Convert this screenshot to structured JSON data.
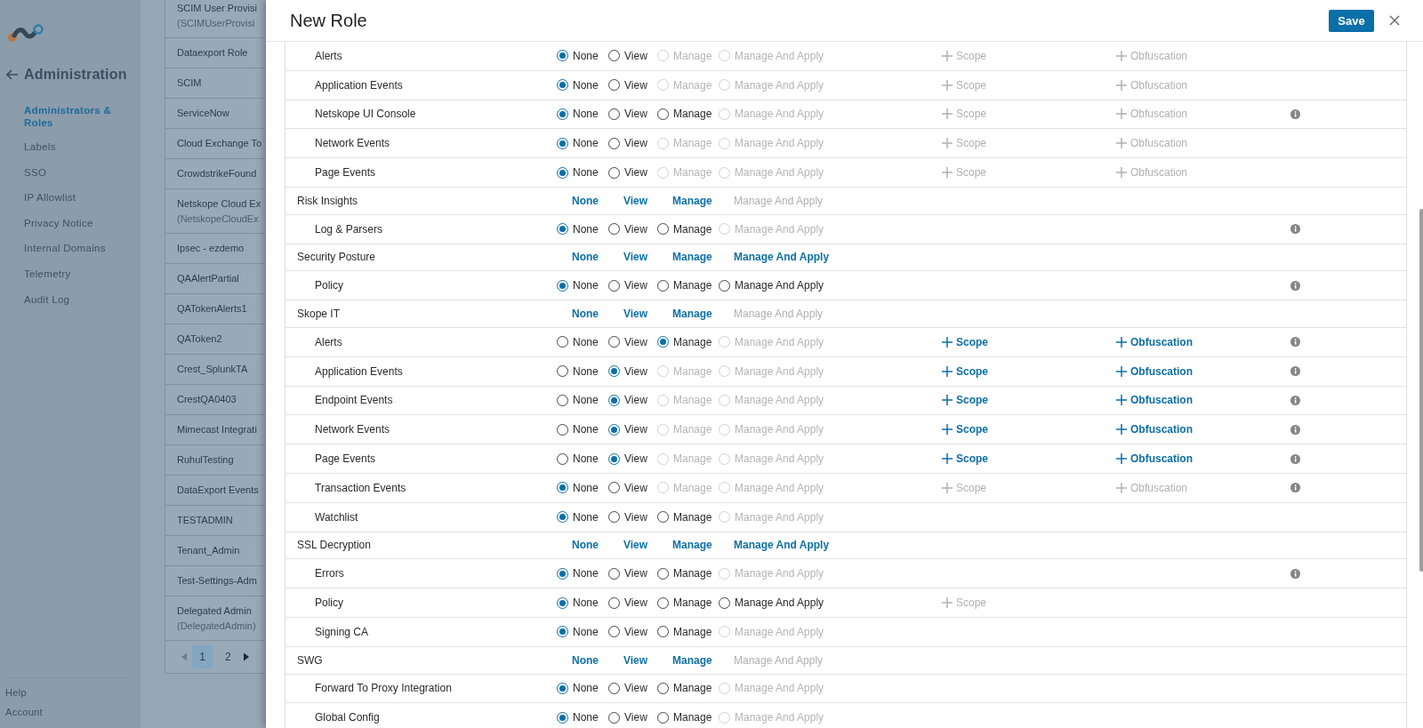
{
  "background": {
    "sidebar": {
      "title": "Administration",
      "items": [
        {
          "label": "Administrators & Roles",
          "selected": true
        },
        {
          "label": "Labels",
          "selected": false
        },
        {
          "label": "SSO",
          "selected": false
        },
        {
          "label": "IP Allowlist",
          "selected": false
        },
        {
          "label": "Privacy Notice",
          "selected": false
        },
        {
          "label": "Internal Domains",
          "selected": false
        },
        {
          "label": "Telemetry",
          "selected": false
        },
        {
          "label": "Audit Log",
          "selected": false
        }
      ],
      "footer_links": [
        "Help",
        "Account"
      ]
    },
    "roles_list": {
      "items": [
        {
          "name": "SCIM User Provisi",
          "subtitle": "(SCIMUserProvisi"
        },
        {
          "name": "Dataexport Role"
        },
        {
          "name": "SCIM"
        },
        {
          "name": "ServiceNow"
        },
        {
          "name": "Cloud Exchange To"
        },
        {
          "name": "CrowdstrikeFound"
        },
        {
          "name": "Netskope Cloud Ex",
          "subtitle": "(NetskopeCloudEx"
        },
        {
          "name": "Ipsec - ezdemo"
        },
        {
          "name": "QAAlertPartial"
        },
        {
          "name": "QATokenAlerts1"
        },
        {
          "name": "QAToken2"
        },
        {
          "name": "Crest_SplunkTA"
        },
        {
          "name": "CrestQA0403"
        },
        {
          "name": "Mimecast Integrati"
        },
        {
          "name": "RuhulTesting"
        },
        {
          "name": "DataExport Events"
        },
        {
          "name": "TESTADMIN"
        },
        {
          "name": "Tenant_Admin"
        },
        {
          "name": "Test-Settings-Adm"
        },
        {
          "name": "Delegated Admin",
          "subtitle": "(DelegatedAdmin)"
        }
      ],
      "pages": [
        {
          "label": "1",
          "selected": true
        },
        {
          "label": "2",
          "selected": false
        }
      ]
    }
  },
  "dialog": {
    "title": "New Role",
    "save_button": "Save",
    "permissions": [
      {
        "kind": "permission",
        "name": "Alerts",
        "options": [
          {
            "label": "None",
            "selected": true,
            "disabled": false
          },
          {
            "label": "View",
            "selected": false,
            "disabled": false
          },
          {
            "label": "Manage",
            "selected": false,
            "disabled": true
          },
          {
            "label": "Manage And Apply",
            "selected": false,
            "disabled": true
          }
        ],
        "scope": {
          "label": "Scope",
          "enabled": false
        },
        "obfuscation": {
          "label": "Obfuscation",
          "enabled": false
        },
        "info": false
      },
      {
        "kind": "permission",
        "name": "Application Events",
        "options": [
          {
            "label": "None",
            "selected": true,
            "disabled": false
          },
          {
            "label": "View",
            "selected": false,
            "disabled": false
          },
          {
            "label": "Manage",
            "selected": false,
            "disabled": true
          },
          {
            "label": "Manage And Apply",
            "selected": false,
            "disabled": true
          }
        ],
        "scope": {
          "label": "Scope",
          "enabled": false
        },
        "obfuscation": {
          "label": "Obfuscation",
          "enabled": false
        },
        "info": false
      },
      {
        "kind": "permission",
        "name": "Netskope UI Console",
        "options": [
          {
            "label": "None",
            "selected": true,
            "disabled": false
          },
          {
            "label": "View",
            "selected": false,
            "disabled": false
          },
          {
            "label": "Manage",
            "selected": false,
            "disabled": false
          },
          {
            "label": "Manage And Apply",
            "selected": false,
            "disabled": true
          }
        ],
        "scope": {
          "label": "Scope",
          "enabled": false
        },
        "obfuscation": {
          "label": "Obfuscation",
          "enabled": false
        },
        "info": true
      },
      {
        "kind": "permission",
        "name": "Network Events",
        "options": [
          {
            "label": "None",
            "selected": true,
            "disabled": false
          },
          {
            "label": "View",
            "selected": false,
            "disabled": false
          },
          {
            "label": "Manage",
            "selected": false,
            "disabled": true
          },
          {
            "label": "Manage And Apply",
            "selected": false,
            "disabled": true
          }
        ],
        "scope": {
          "label": "Scope",
          "enabled": false
        },
        "obfuscation": {
          "label": "Obfuscation",
          "enabled": false
        },
        "info": false
      },
      {
        "kind": "permission",
        "name": "Page Events",
        "options": [
          {
            "label": "None",
            "selected": true,
            "disabled": false
          },
          {
            "label": "View",
            "selected": false,
            "disabled": false
          },
          {
            "label": "Manage",
            "selected": false,
            "disabled": true
          },
          {
            "label": "Manage And Apply",
            "selected": false,
            "disabled": true
          }
        ],
        "scope": {
          "label": "Scope",
          "enabled": false
        },
        "obfuscation": {
          "label": "Obfuscation",
          "enabled": false
        },
        "info": false
      },
      {
        "kind": "group",
        "name": "Risk Insights",
        "options": [
          {
            "label": "None",
            "enabled": true
          },
          {
            "label": "View",
            "enabled": true
          },
          {
            "label": "Manage",
            "enabled": true
          },
          {
            "label": "Manage And Apply",
            "enabled": false
          }
        ]
      },
      {
        "kind": "permission",
        "name": "Log & Parsers",
        "options": [
          {
            "label": "None",
            "selected": true,
            "disabled": false
          },
          {
            "label": "View",
            "selected": false,
            "disabled": false
          },
          {
            "label": "Manage",
            "selected": false,
            "disabled": false
          },
          {
            "label": "Manage And Apply",
            "selected": false,
            "disabled": true
          }
        ],
        "info": true
      },
      {
        "kind": "group",
        "name": "Security Posture",
        "options": [
          {
            "label": "None",
            "enabled": true
          },
          {
            "label": "View",
            "enabled": true
          },
          {
            "label": "Manage",
            "enabled": true
          },
          {
            "label": "Manage And Apply",
            "enabled": true
          }
        ]
      },
      {
        "kind": "permission",
        "name": "Policy",
        "options": [
          {
            "label": "None",
            "selected": true,
            "disabled": false
          },
          {
            "label": "View",
            "selected": false,
            "disabled": false
          },
          {
            "label": "Manage",
            "selected": false,
            "disabled": false
          },
          {
            "label": "Manage And Apply",
            "selected": false,
            "disabled": false
          }
        ],
        "info": true
      },
      {
        "kind": "group",
        "name": "Skope IT",
        "options": [
          {
            "label": "None",
            "enabled": true
          },
          {
            "label": "View",
            "enabled": true
          },
          {
            "label": "Manage",
            "enabled": true
          },
          {
            "label": "Manage And Apply",
            "enabled": false
          }
        ]
      },
      {
        "kind": "permission",
        "name": "Alerts",
        "options": [
          {
            "label": "None",
            "selected": false,
            "disabled": false
          },
          {
            "label": "View",
            "selected": false,
            "disabled": false
          },
          {
            "label": "Manage",
            "selected": true,
            "disabled": false
          },
          {
            "label": "Manage And Apply",
            "selected": false,
            "disabled": true
          }
        ],
        "scope": {
          "label": "Scope",
          "enabled": true
        },
        "obfuscation": {
          "label": "Obfuscation",
          "enabled": true
        },
        "info": true
      },
      {
        "kind": "permission",
        "name": "Application Events",
        "options": [
          {
            "label": "None",
            "selected": false,
            "disabled": false
          },
          {
            "label": "View",
            "selected": true,
            "disabled": false
          },
          {
            "label": "Manage",
            "selected": false,
            "disabled": true
          },
          {
            "label": "Manage And Apply",
            "selected": false,
            "disabled": true
          }
        ],
        "scope": {
          "label": "Scope",
          "enabled": true
        },
        "obfuscation": {
          "label": "Obfuscation",
          "enabled": true
        },
        "info": true
      },
      {
        "kind": "permission",
        "name": "Endpoint Events",
        "options": [
          {
            "label": "None",
            "selected": false,
            "disabled": false
          },
          {
            "label": "View",
            "selected": true,
            "disabled": false
          },
          {
            "label": "Manage",
            "selected": false,
            "disabled": true
          },
          {
            "label": "Manage And Apply",
            "selected": false,
            "disabled": true
          }
        ],
        "scope": {
          "label": "Scope",
          "enabled": true
        },
        "obfuscation": {
          "label": "Obfuscation",
          "enabled": true
        },
        "info": true
      },
      {
        "kind": "permission",
        "name": "Network Events",
        "options": [
          {
            "label": "None",
            "selected": false,
            "disabled": false
          },
          {
            "label": "View",
            "selected": true,
            "disabled": false
          },
          {
            "label": "Manage",
            "selected": false,
            "disabled": true
          },
          {
            "label": "Manage And Apply",
            "selected": false,
            "disabled": true
          }
        ],
        "scope": {
          "label": "Scope",
          "enabled": true
        },
        "obfuscation": {
          "label": "Obfuscation",
          "enabled": true
        },
        "info": true
      },
      {
        "kind": "permission",
        "name": "Page Events",
        "options": [
          {
            "label": "None",
            "selected": false,
            "disabled": false
          },
          {
            "label": "View",
            "selected": true,
            "disabled": false
          },
          {
            "label": "Manage",
            "selected": false,
            "disabled": true
          },
          {
            "label": "Manage And Apply",
            "selected": false,
            "disabled": true
          }
        ],
        "scope": {
          "label": "Scope",
          "enabled": true
        },
        "obfuscation": {
          "label": "Obfuscation",
          "enabled": true
        },
        "info": true
      },
      {
        "kind": "permission",
        "name": "Transaction Events",
        "options": [
          {
            "label": "None",
            "selected": true,
            "disabled": false
          },
          {
            "label": "View",
            "selected": false,
            "disabled": false
          },
          {
            "label": "Manage",
            "selected": false,
            "disabled": true
          },
          {
            "label": "Manage And Apply",
            "selected": false,
            "disabled": true
          }
        ],
        "scope": {
          "label": "Scope",
          "enabled": false
        },
        "obfuscation": {
          "label": "Obfuscation",
          "enabled": false
        },
        "info": true
      },
      {
        "kind": "permission",
        "name": "Watchlist",
        "options": [
          {
            "label": "None",
            "selected": true,
            "disabled": false
          },
          {
            "label": "View",
            "selected": false,
            "disabled": false
          },
          {
            "label": "Manage",
            "selected": false,
            "disabled": false
          },
          {
            "label": "Manage And Apply",
            "selected": false,
            "disabled": true
          }
        ],
        "info": false
      },
      {
        "kind": "group",
        "name": "SSL Decryption",
        "options": [
          {
            "label": "None",
            "enabled": true
          },
          {
            "label": "View",
            "enabled": true
          },
          {
            "label": "Manage",
            "enabled": true
          },
          {
            "label": "Manage And Apply",
            "enabled": true
          }
        ]
      },
      {
        "kind": "permission",
        "name": "Errors",
        "options": [
          {
            "label": "None",
            "selected": true,
            "disabled": false
          },
          {
            "label": "View",
            "selected": false,
            "disabled": false
          },
          {
            "label": "Manage",
            "selected": false,
            "disabled": false
          },
          {
            "label": "Manage And Apply",
            "selected": false,
            "disabled": true
          }
        ],
        "info": true
      },
      {
        "kind": "permission",
        "name": "Policy",
        "options": [
          {
            "label": "None",
            "selected": true,
            "disabled": false
          },
          {
            "label": "View",
            "selected": false,
            "disabled": false
          },
          {
            "label": "Manage",
            "selected": false,
            "disabled": false
          },
          {
            "label": "Manage And Apply",
            "selected": false,
            "disabled": false
          }
        ],
        "scope": {
          "label": "Scope",
          "enabled": false
        },
        "info": false
      },
      {
        "kind": "permission",
        "name": "Signing CA",
        "options": [
          {
            "label": "None",
            "selected": true,
            "disabled": false
          },
          {
            "label": "View",
            "selected": false,
            "disabled": false
          },
          {
            "label": "Manage",
            "selected": false,
            "disabled": false
          },
          {
            "label": "Manage And Apply",
            "selected": false,
            "disabled": true
          }
        ],
        "info": false
      },
      {
        "kind": "group",
        "name": "SWG",
        "options": [
          {
            "label": "None",
            "enabled": true
          },
          {
            "label": "View",
            "enabled": true
          },
          {
            "label": "Manage",
            "enabled": true
          },
          {
            "label": "Manage And Apply",
            "enabled": false
          }
        ]
      },
      {
        "kind": "permission",
        "name": "Forward To Proxy Integration",
        "options": [
          {
            "label": "None",
            "selected": true,
            "disabled": false
          },
          {
            "label": "View",
            "selected": false,
            "disabled": false
          },
          {
            "label": "Manage",
            "selected": false,
            "disabled": false
          },
          {
            "label": "Manage And Apply",
            "selected": false,
            "disabled": true
          }
        ],
        "info": false
      },
      {
        "kind": "permission",
        "name": "Global Config",
        "options": [
          {
            "label": "None",
            "selected": true,
            "disabled": false
          },
          {
            "label": "View",
            "selected": false,
            "disabled": false
          },
          {
            "label": "Manage",
            "selected": false,
            "disabled": false
          },
          {
            "label": "Manage And Apply",
            "selected": false,
            "disabled": true
          }
        ],
        "info": false
      }
    ]
  }
}
